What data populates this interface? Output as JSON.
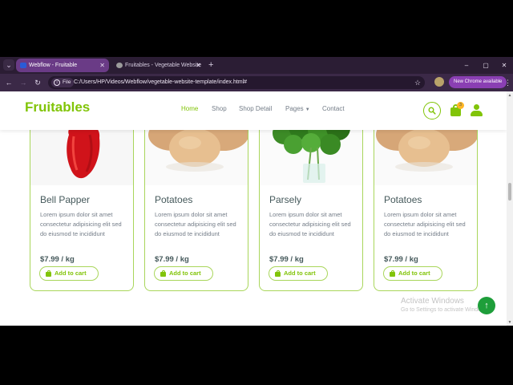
{
  "browser": {
    "tabs": [
      {
        "title": "Webflow - Fruitable",
        "active": true,
        "favicon_color": "#2a5bd7"
      },
      {
        "title": "Fruitables - Vegetable Website",
        "active": false,
        "favicon_color": "#9b9b9b"
      }
    ],
    "new_tab_label": "+",
    "address": {
      "chip_label": "File",
      "url": "C:/Users/HP/Videos/Webflow/vegetable-website-template/index.html#"
    },
    "update_label": "New Chrome available",
    "controls": {
      "minimize": "–",
      "maximize": "▢",
      "close": "✕"
    }
  },
  "site": {
    "logo": "Fruitables",
    "accent_color": "#81c408",
    "nav": [
      {
        "label": "Home",
        "active": true
      },
      {
        "label": "Shop",
        "active": false
      },
      {
        "label": "Shop Detail",
        "active": false
      },
      {
        "label": "Pages",
        "active": false,
        "dropdown": true
      },
      {
        "label": "Contact",
        "active": false
      }
    ],
    "cart_count": "3"
  },
  "products": [
    {
      "name": "Bell Papper",
      "description": "Lorem ipsum dolor sit amet consectetur adipisicing elit sed do eiusmod te incididunt",
      "price": "$7.99 / kg",
      "button": "Add to cart",
      "image": "bell-pepper"
    },
    {
      "name": "Potatoes",
      "description": "Lorem ipsum dolor sit amet consectetur adipisicing elit sed do eiusmod te incididunt",
      "price": "$7.99 / kg",
      "button": "Add to cart",
      "image": "potatoes"
    },
    {
      "name": "Parsely",
      "description": "Lorem ipsum dolor sit amet consectetur adipisicing elit sed do eiusmod te incididunt",
      "price": "$7.99 / kg",
      "button": "Add to cart",
      "image": "parsley"
    },
    {
      "name": "Potatoes",
      "description": "Lorem ipsum dolor sit amet consectetur adipisicing elit sed do eiusmod te incididunt",
      "price": "$7.99 / kg",
      "button": "Add to cart",
      "image": "potatoes"
    }
  ],
  "watermark": {
    "title": "Activate Windows",
    "subtitle": "Go to Settings to activate Windows."
  },
  "back_to_top": "↑"
}
